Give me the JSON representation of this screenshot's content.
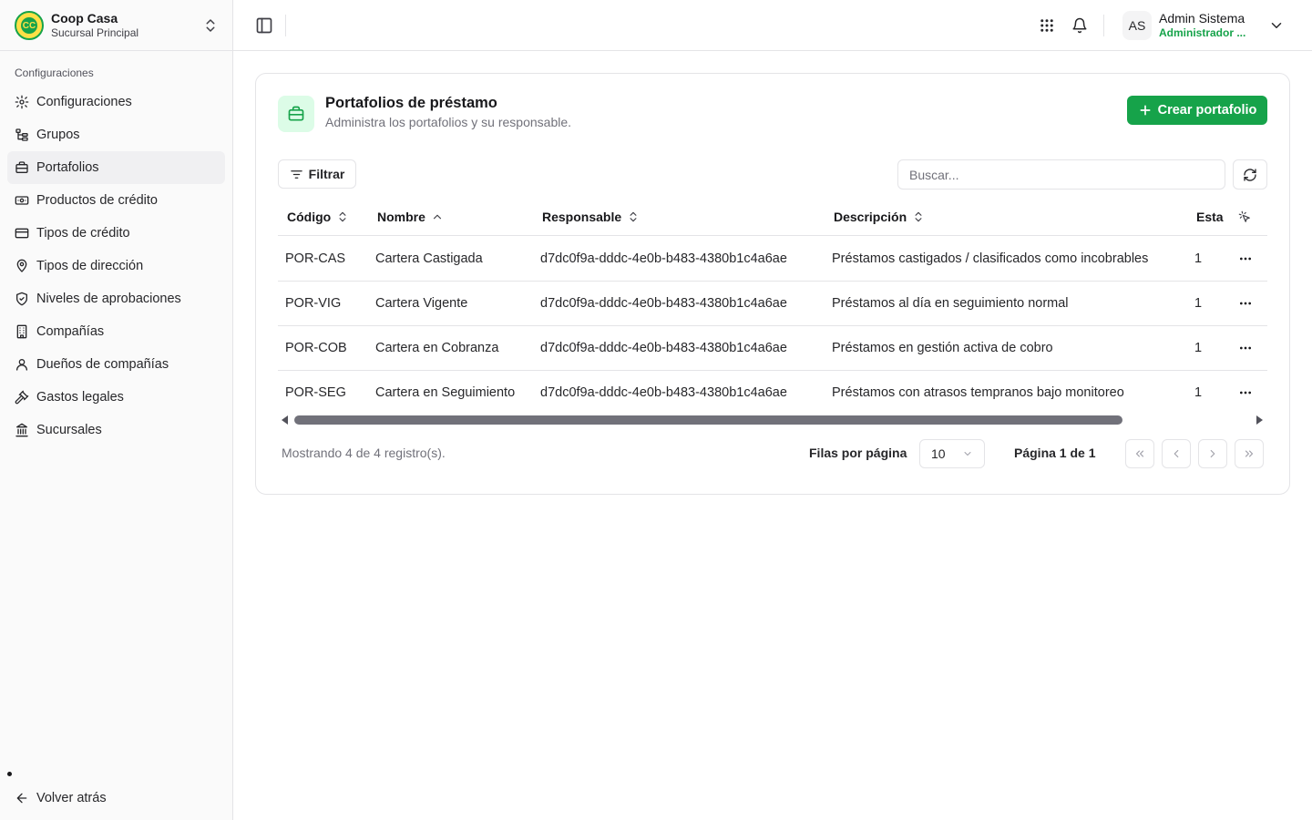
{
  "org": {
    "name": "Coop Casa",
    "branch": "Sucursal Principal",
    "logo_text": "CC"
  },
  "sidebar": {
    "section_label": "Configuraciones",
    "items": [
      {
        "label": "Configuraciones",
        "icon": "gear-icon",
        "active": false
      },
      {
        "label": "Grupos",
        "icon": "group-tree-icon",
        "active": false
      },
      {
        "label": "Portafolios",
        "icon": "briefcase-icon",
        "active": true
      },
      {
        "label": "Productos de crédito",
        "icon": "banknote-icon",
        "active": false
      },
      {
        "label": "Tipos de crédito",
        "icon": "credit-card-icon",
        "active": false
      },
      {
        "label": "Tipos de dirección",
        "icon": "map-pin-icon",
        "active": false
      },
      {
        "label": "Niveles de aprobaciones",
        "icon": "shield-check-icon",
        "active": false
      },
      {
        "label": "Compañías",
        "icon": "building-icon",
        "active": false
      },
      {
        "label": "Dueños de compañías",
        "icon": "user-icon",
        "active": false
      },
      {
        "label": "Gastos legales",
        "icon": "gavel-icon",
        "active": false
      },
      {
        "label": "Sucursales",
        "icon": "landmark-icon",
        "active": false
      }
    ],
    "back_label": "Volver atrás"
  },
  "header": {
    "user_initials": "AS",
    "user_name": "Admin Sistema",
    "user_role": "Administrador ..."
  },
  "page": {
    "title": "Portafolios de préstamo",
    "subtitle": "Administra los portafolios y su responsable.",
    "create_label": "Crear portafolio",
    "filter_label": "Filtrar",
    "search_placeholder": "Buscar...",
    "accent_color": "#16a34a"
  },
  "table": {
    "columns": [
      "Código",
      "Nombre",
      "Responsable",
      "Descripción",
      "Esta"
    ],
    "rows": [
      {
        "codigo": "POR-CAS",
        "nombre": "Cartera Castigada",
        "responsable": "d7dc0f9a-dddc-4e0b-b483-4380b1c4a6ae",
        "descripcion": "Préstamos castigados / clasificados como incobrables",
        "estado": "1"
      },
      {
        "codigo": "POR-VIG",
        "nombre": "Cartera Vigente",
        "responsable": "d7dc0f9a-dddc-4e0b-b483-4380b1c4a6ae",
        "descripcion": "Préstamos al día en seguimiento normal",
        "estado": "1"
      },
      {
        "codigo": "POR-COB",
        "nombre": "Cartera en Cobranza",
        "responsable": "d7dc0f9a-dddc-4e0b-b483-4380b1c4a6ae",
        "descripcion": "Préstamos en gestión activa de cobro",
        "estado": "1"
      },
      {
        "codigo": "POR-SEG",
        "nombre": "Cartera en Seguimiento",
        "responsable": "d7dc0f9a-dddc-4e0b-b483-4380b1c4a6ae",
        "descripcion": "Préstamos con atrasos tempranos bajo monitoreo",
        "estado": "1"
      }
    ]
  },
  "footer": {
    "showing": "Mostrando 4 de 4 registro(s).",
    "rows_per_page_label": "Filas por página",
    "rows_per_page_value": "10",
    "page_info": "Página 1 de 1"
  }
}
